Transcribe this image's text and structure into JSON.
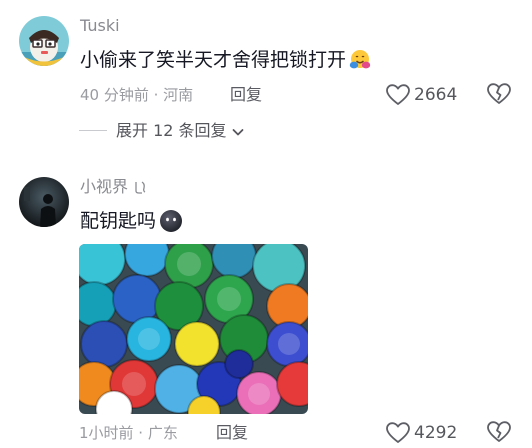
{
  "comments": [
    {
      "username": "Tuski",
      "text": "小偷来了笑半天才舍得把锁打开",
      "emoji": "hugging-face",
      "time_location": "40 分钟前 · 河南",
      "reply_label": "回复",
      "likes": "2664",
      "expand_replies_label": "展开 12 条回复"
    },
    {
      "username": "小视界",
      "text": "配钥匙吗",
      "emoji": "dark-face",
      "time_location": "1小时前 · 广东",
      "reply_label": "回复",
      "likes": "4292"
    }
  ],
  "colors": {
    "username": "#8a8b91",
    "text": "#161823",
    "meta": "#9a9ba1",
    "divider": "#c9cacf"
  },
  "icons": [
    "heart-outline-icon",
    "broken-heart-icon",
    "chevron-down-icon"
  ]
}
